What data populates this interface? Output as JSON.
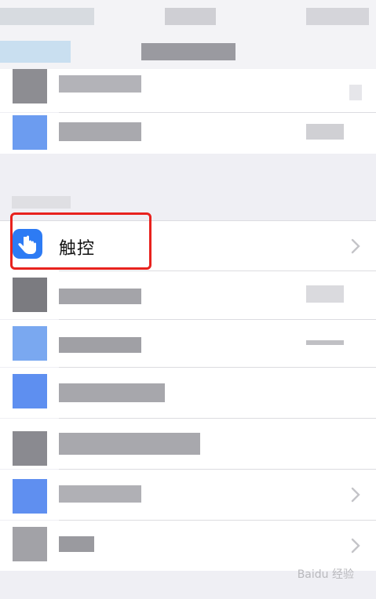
{
  "section": {
    "header": "",
    "highlighted_item": {
      "label": "触控",
      "icon": "hand-pointer-icon",
      "accent_color": "#2d7bf4"
    }
  },
  "chevron_icon": "chevron-right-icon",
  "highlight_color": "#e8221e",
  "watermark": "Baidu 经验"
}
